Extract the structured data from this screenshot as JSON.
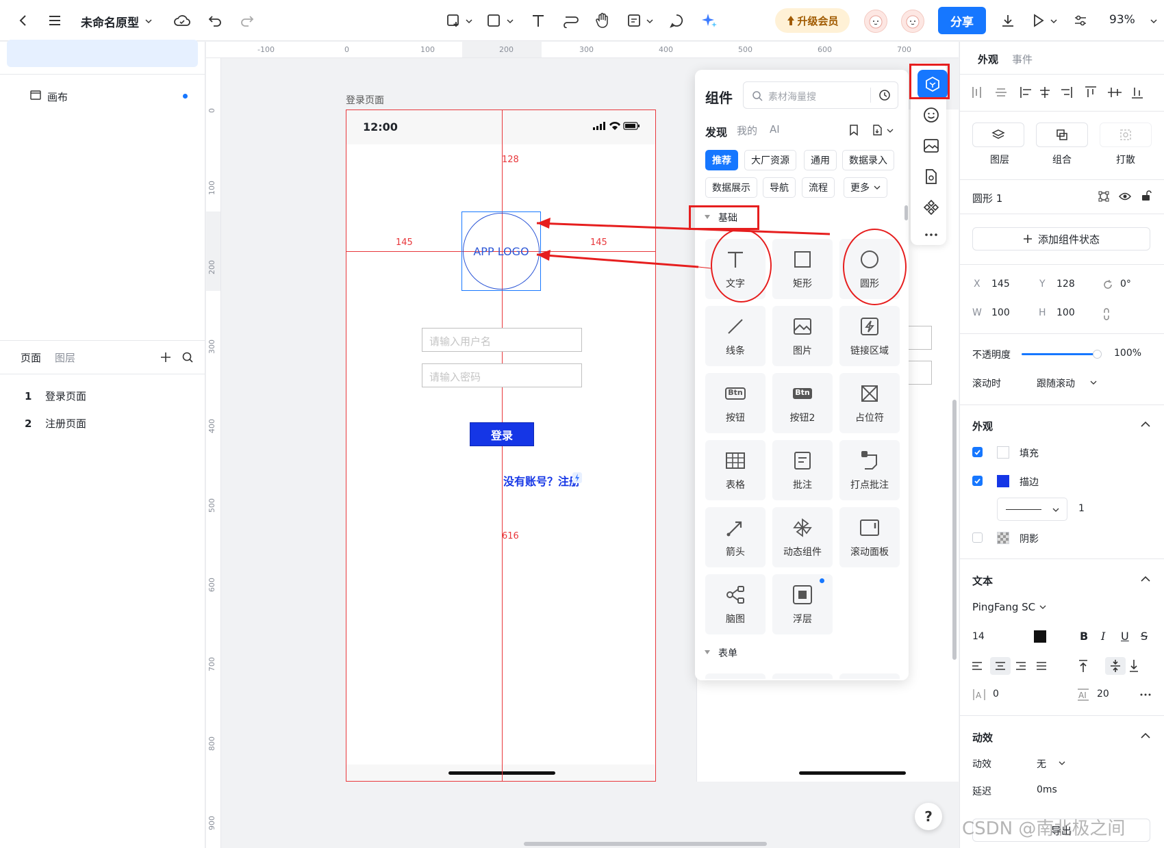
{
  "topbar": {
    "doc_title": "未命名原型",
    "upgrade_label": "升级会员",
    "share_label": "分享",
    "zoom": "93%"
  },
  "left_panel": {
    "canvas_title": "画布",
    "canvas_item": "画布",
    "tab_pages": "页面",
    "tab_layers": "图层",
    "pages": [
      {
        "num": "1",
        "name": "登录页面"
      },
      {
        "num": "2",
        "name": "注册页面"
      }
    ]
  },
  "rulers": {
    "top": [
      "-100",
      "0",
      "100",
      "200",
      "300",
      "400",
      "500",
      "600",
      "700"
    ],
    "left": [
      "0",
      "100",
      "200",
      "300",
      "400",
      "500",
      "600",
      "700",
      "800",
      "900"
    ]
  },
  "canvas": {
    "frame_label": "登录页面",
    "time": "12:00",
    "logo_text": "APP LOGO",
    "username_placeholder": "请输入用户名",
    "password_placeholder": "请输入密码",
    "login_label": "登录",
    "register_text": "没有账号？注册",
    "measure_top": "128",
    "measure_left": "145",
    "measure_right": "145",
    "measure_bottom": "616"
  },
  "components": {
    "title": "组件",
    "search_placeholder": "素材海量搜",
    "tabs": [
      "发现",
      "我的",
      "AI"
    ],
    "chips": [
      "推荐",
      "大厂资源",
      "通用",
      "数据录入",
      "数据展示",
      "导航",
      "流程",
      "更多"
    ],
    "section_basic": "基础",
    "section_form": "表单",
    "tiles": [
      "文字",
      "矩形",
      "圆形",
      "线条",
      "图片",
      "链接区域",
      "按钮",
      "按钮2",
      "占位符",
      "表格",
      "批注",
      "打点批注",
      "箭头",
      "动态组件",
      "滚动面板",
      "脑图",
      "浮层"
    ],
    "btn_icon_text": "Btn"
  },
  "right_panel": {
    "tab_appearance": "外观",
    "tab_events": "事件",
    "layer_label": "图层",
    "group_label": "组合",
    "scatter_label": "打散",
    "element_name": "圆形 1",
    "add_state": "添加组件状态",
    "x_label": "X",
    "x_value": "145",
    "y_label": "Y",
    "y_value": "128",
    "rotation": "0°",
    "w_label": "W",
    "w_value": "100",
    "h_label": "H",
    "h_value": "100",
    "opacity_label": "不透明度",
    "opacity_value": "100%",
    "opacity_fraction": 1.0,
    "scroll_label": "滚动时",
    "scroll_value": "跟随滚动",
    "appearance_section": "外观",
    "fill_label": "填充",
    "stroke_label": "描边",
    "stroke_width": "1",
    "shadow_label": "阴影",
    "text_section": "文本",
    "font_name": "PingFang SC",
    "font_size": "14",
    "letter_spacing": "0",
    "line_height": "20",
    "anim_section": "动效",
    "anim_label": "动效",
    "anim_value": "无",
    "delay_label": "延迟",
    "delay_value": "0ms",
    "export_label": "导出"
  },
  "colors": {
    "accent": "#1677ff",
    "guide": "#e8373b",
    "login_button": "#1536e6",
    "stroke_swatch": "#1536e6"
  },
  "watermark": "CSDN @南北极之间"
}
